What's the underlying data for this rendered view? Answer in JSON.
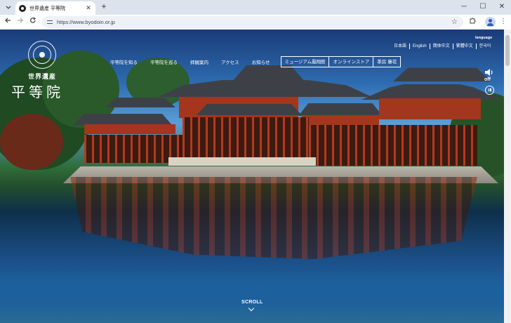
{
  "browser": {
    "tab_title": "世界遺産 平等院",
    "url": "https://www.byodoin.or.jp"
  },
  "site": {
    "logo_sub": "世界遺産",
    "logo_main": "平等院",
    "nav": [
      {
        "label": "平等院を知る"
      },
      {
        "label": "平等院を巡る"
      },
      {
        "label": "拝観案内"
      },
      {
        "label": "アクセス"
      },
      {
        "label": "お知らせ"
      }
    ],
    "nav_boxed": [
      {
        "label": "ミュージアム鳳翔館"
      },
      {
        "label": "オンラインストア"
      },
      {
        "label": "茶房 藤花"
      }
    ],
    "language_heading": "language",
    "languages": [
      "日本語",
      "English",
      "簡体中文",
      "繁體中文",
      "한국어"
    ],
    "sound_state": "off",
    "scroll_label": "SCROLL"
  },
  "icons": {
    "tab_dropdown": "chevron-down-icon",
    "favicon": "byodoin-crest-icon",
    "close": "close-icon",
    "new_tab": "plus-icon",
    "back": "arrow-left-icon",
    "forward": "arrow-right-icon",
    "reload": "reload-icon",
    "bookmark": "star-icon",
    "extensions": "puzzle-icon",
    "profile": "profile-icon",
    "menu": "kebab-menu-icon",
    "sound": "speaker-icon",
    "pause": "pause-icon"
  },
  "colors": {
    "chrome_bg": "#dde3ec",
    "overlay_text": "#ffffff",
    "temple_red": "#a3361c"
  }
}
